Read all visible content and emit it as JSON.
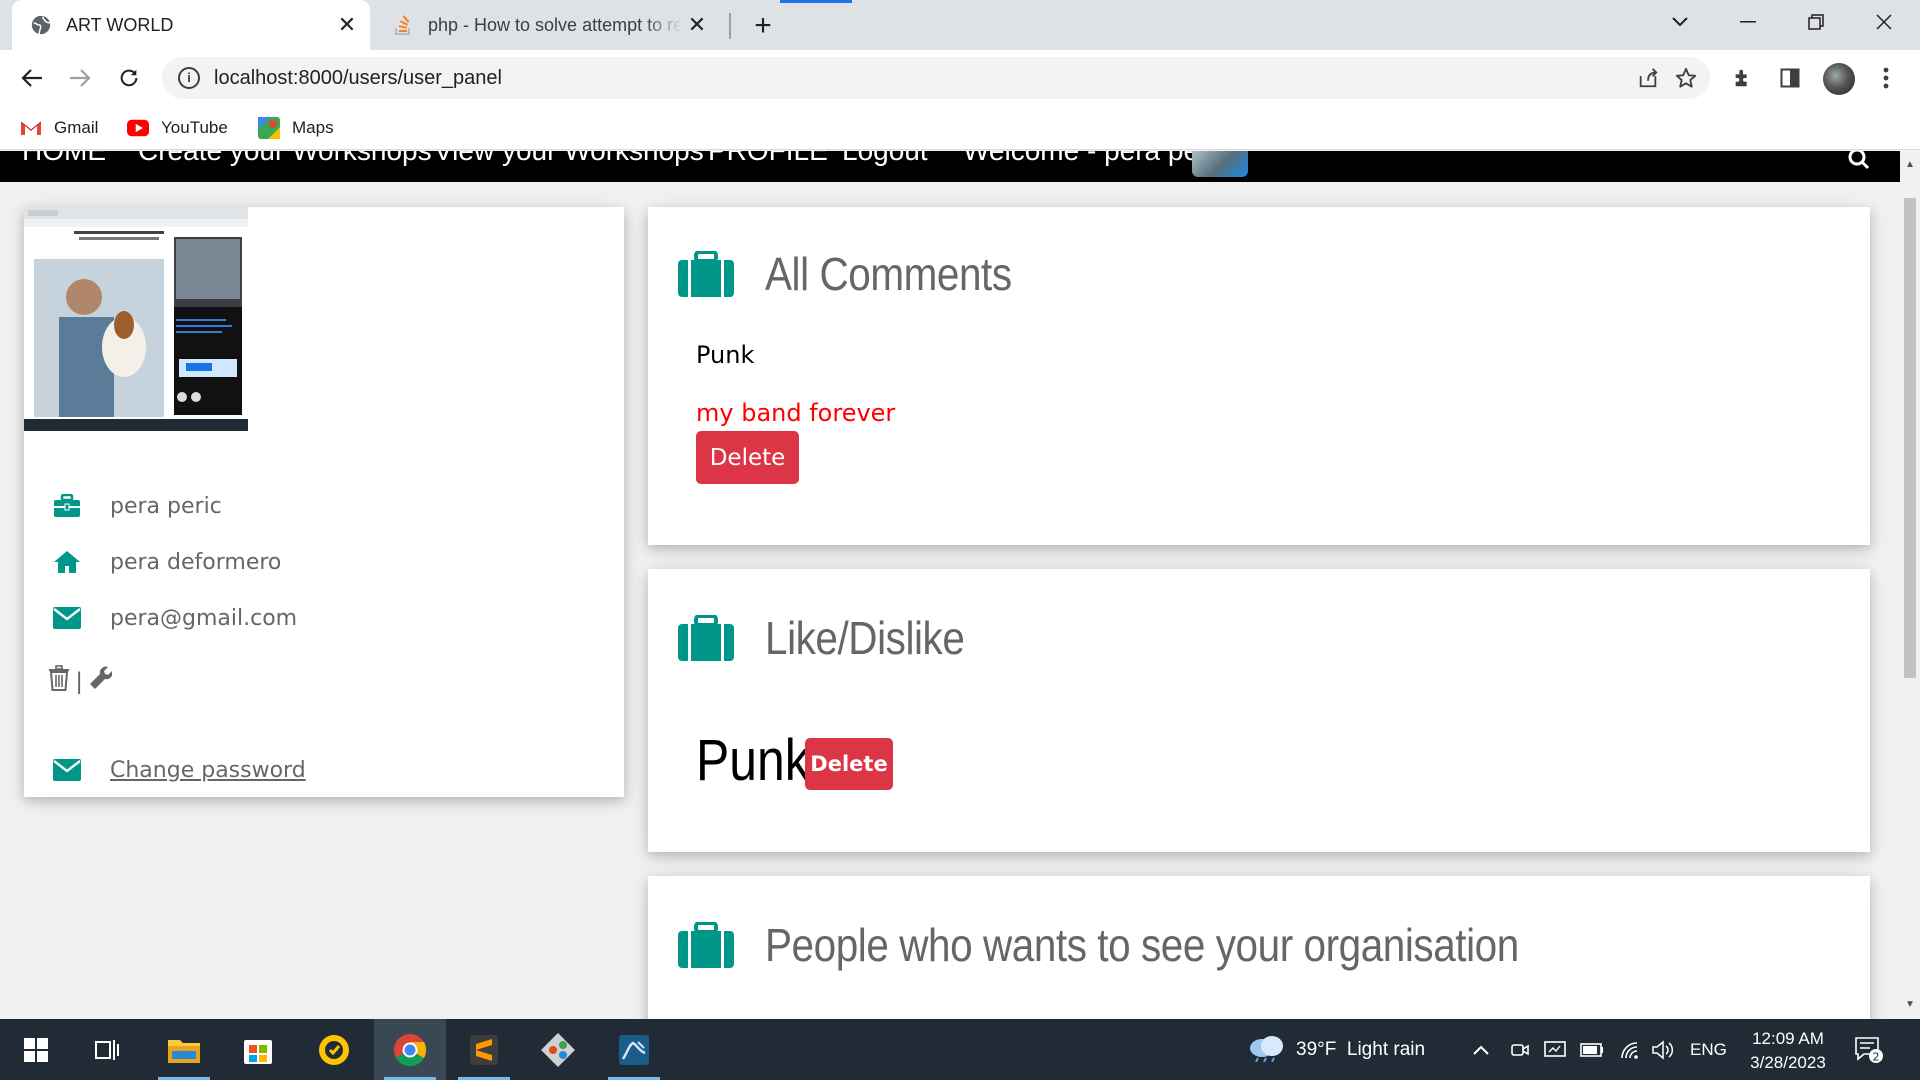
{
  "browser": {
    "tabs": [
      {
        "title": "ART WORLD",
        "active": true
      },
      {
        "title": "php - How to solve attempt to re",
        "active": false
      }
    ],
    "url": "localhost:8000/users/user_panel",
    "bookmarks": [
      {
        "label": "Gmail",
        "icon": "gmail-icon"
      },
      {
        "label": "YouTube",
        "icon": "youtube-icon"
      },
      {
        "label": "Maps",
        "icon": "maps-icon"
      }
    ]
  },
  "site_nav": {
    "items": [
      "HOME",
      "Create your Workshops",
      "View your Workshops",
      "PROFILE",
      "Logout",
      "Welcome - pera peric"
    ]
  },
  "profile": {
    "name": "pera peric",
    "address": "pera deformero",
    "email": "pera@gmail.com",
    "separator": "|",
    "change_password": "Change password"
  },
  "comments_section": {
    "title": "All Comments",
    "category": "Punk",
    "comment": "my band forever",
    "delete_label": "Delete"
  },
  "like_section": {
    "title": "Like/Dislike",
    "category": "Punk",
    "delete_label": "Delete"
  },
  "people_section": {
    "title": "People who wants to see your organisation"
  },
  "taskbar": {
    "weather": "39°F  Light rain",
    "language": "ENG",
    "time": "12:09 AM",
    "date": "3/28/2023",
    "notifications": "2"
  },
  "colors": {
    "accent": "#009688",
    "danger": "#dc3545",
    "comment_text": "#ff0000"
  }
}
